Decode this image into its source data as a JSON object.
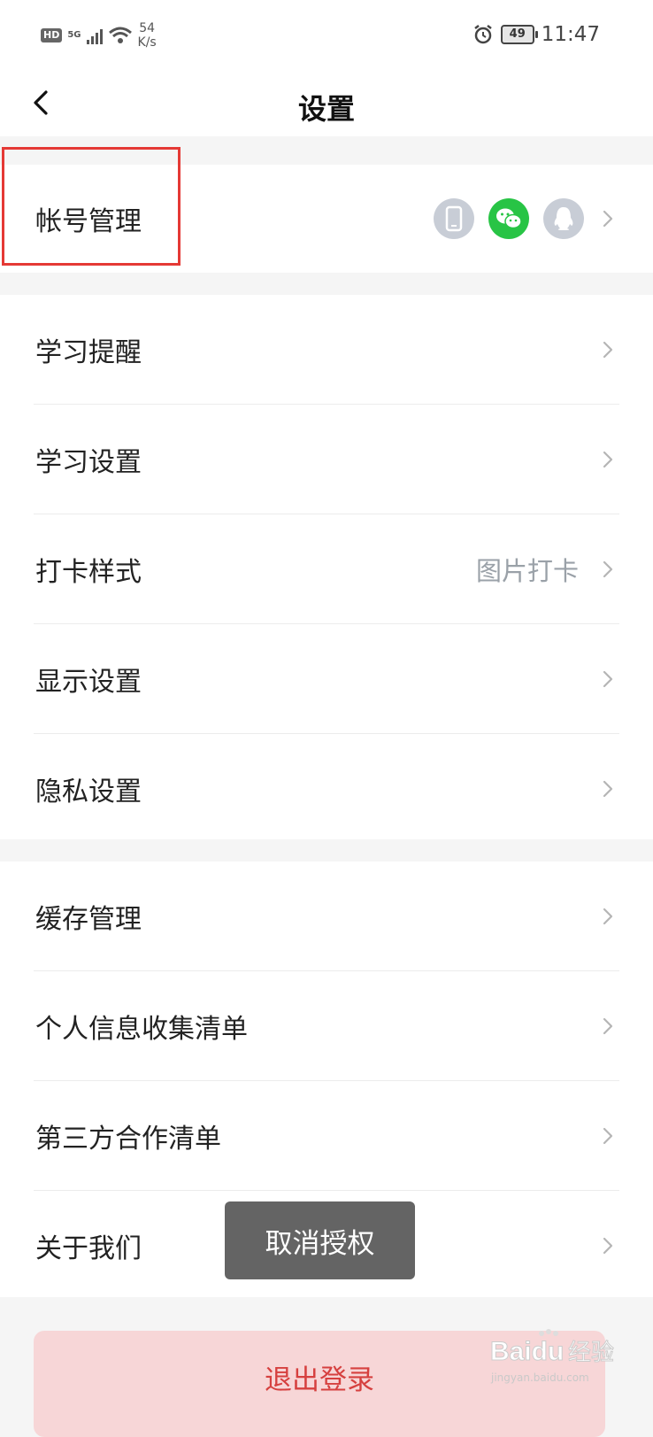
{
  "status_bar": {
    "hd": "HD",
    "network": "5G",
    "net_speed_value": "54",
    "net_speed_unit": "K/s",
    "battery": "49",
    "time": "11:47"
  },
  "header": {
    "title": "设置"
  },
  "account": {
    "label": "帐号管理",
    "linked_icons": [
      "phone-icon",
      "wechat-icon",
      "qq-icon"
    ]
  },
  "group_learning": {
    "items": [
      {
        "label": "学习提醒"
      },
      {
        "label": "学习设置"
      },
      {
        "label": "打卡样式",
        "value": "图片打卡"
      },
      {
        "label": "显示设置"
      },
      {
        "label": "隐私设置"
      }
    ]
  },
  "group_misc": {
    "items": [
      {
        "label": "缓存管理"
      },
      {
        "label": "个人信息收集清单"
      },
      {
        "label": "第三方合作清单"
      },
      {
        "label": "关于我们"
      }
    ]
  },
  "toast": {
    "text": "取消授权"
  },
  "logout": {
    "label": "退出登录"
  },
  "watermark": {
    "brand": "Baidu 经验",
    "url": "jingyan.baidu.com"
  },
  "colors": {
    "highlight": "#e53935",
    "wechat_green": "#28c445",
    "logout_text": "#d6403f",
    "logout_bg": "#f7d6d7"
  }
}
